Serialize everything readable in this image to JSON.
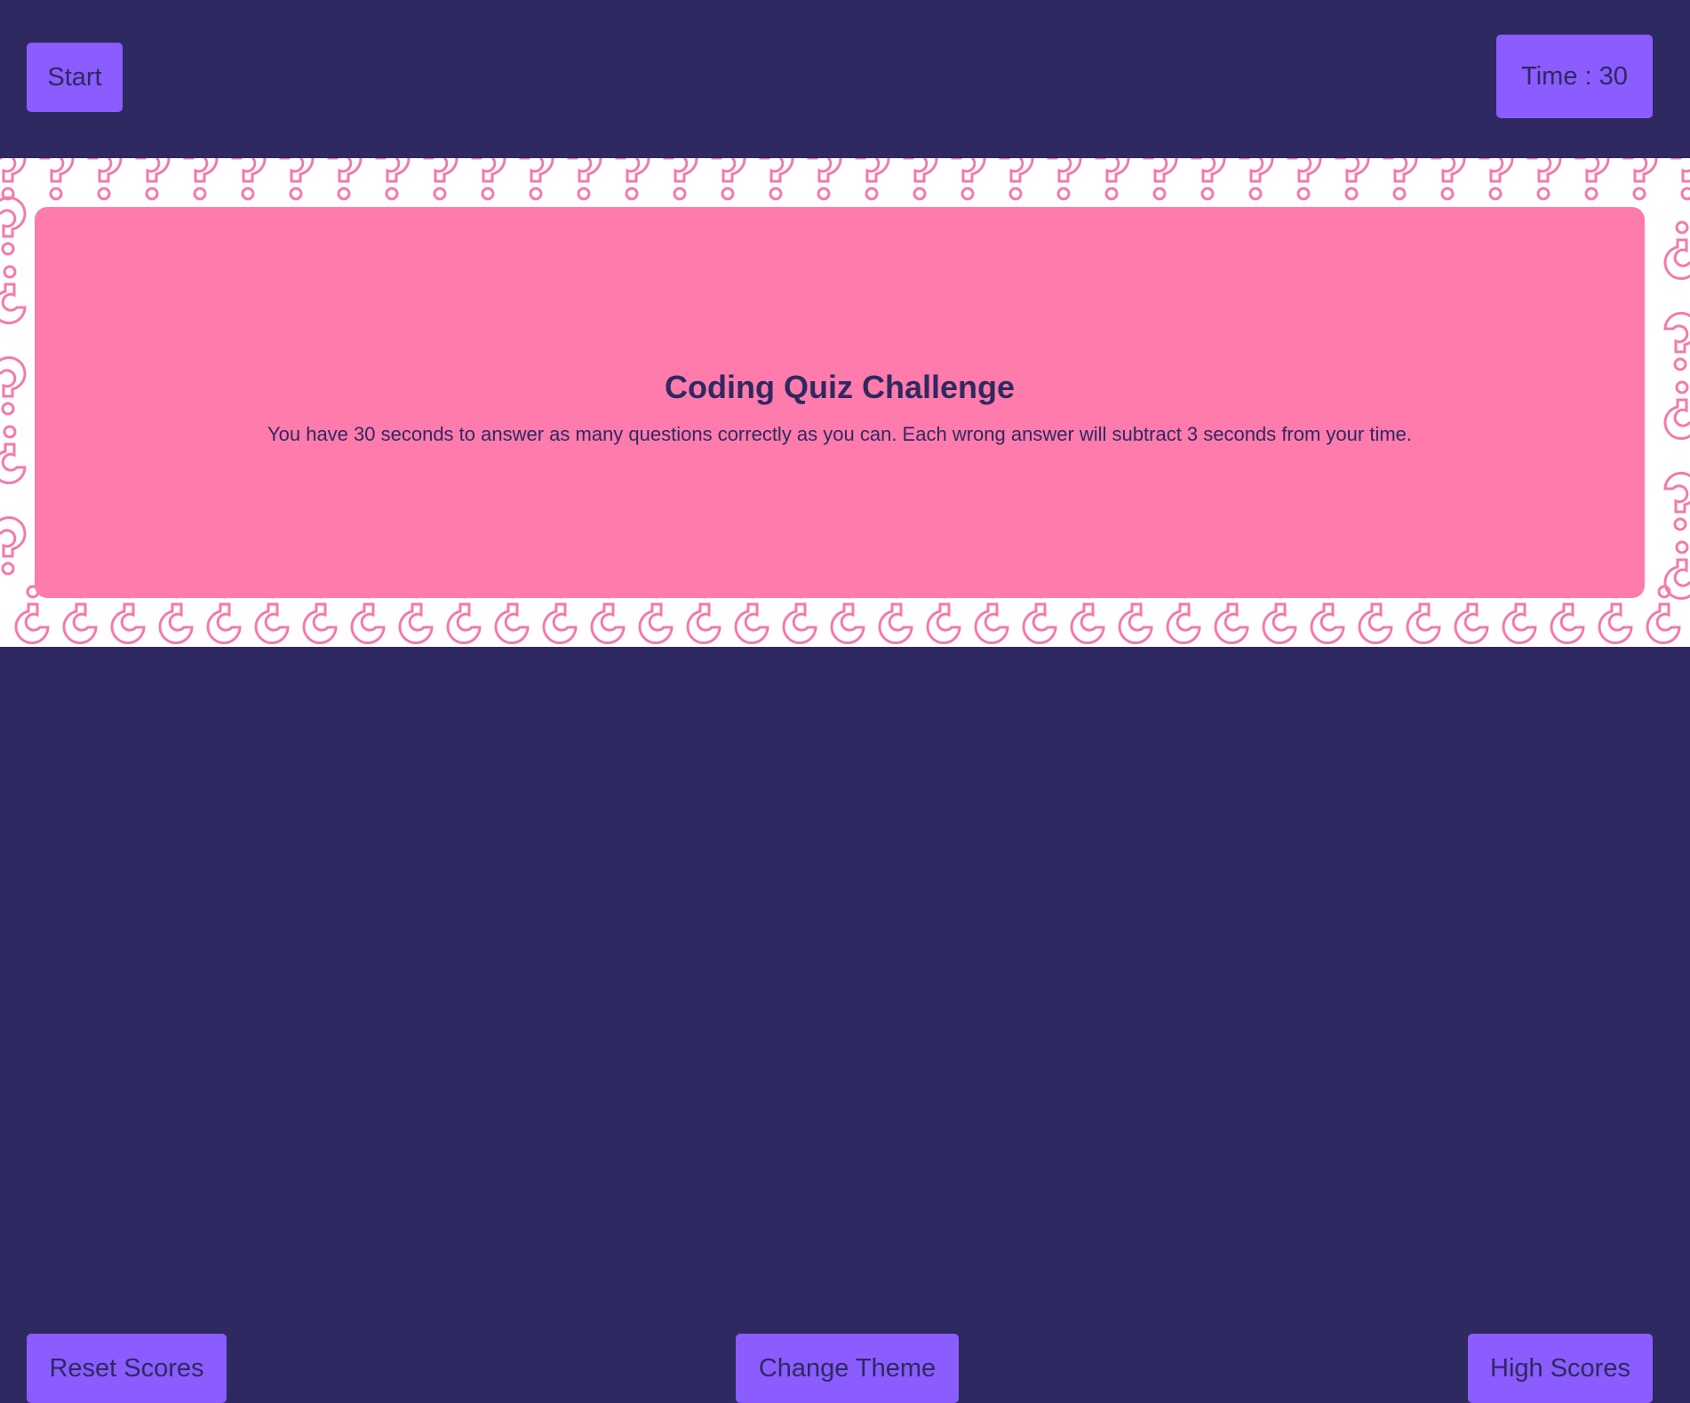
{
  "header": {
    "start_label": "Start",
    "timer_label": "Time : 30"
  },
  "quiz": {
    "title": "Coding Quiz Challenge",
    "description": "You have 30 seconds to answer as many questions correctly as you can. Each wrong answer will subtract 3 seconds from your time."
  },
  "footer": {
    "reset_label": "Reset Scores",
    "theme_label": "Change Theme",
    "high_scores_label": "High Scores"
  },
  "colors": {
    "background": "#2e2960",
    "button": "#8b5cff",
    "card": "#ff7bac",
    "pattern_stroke": "#f47aaa",
    "text": "#2e2960"
  },
  "icons": {
    "pattern": "question-mark-pattern"
  }
}
